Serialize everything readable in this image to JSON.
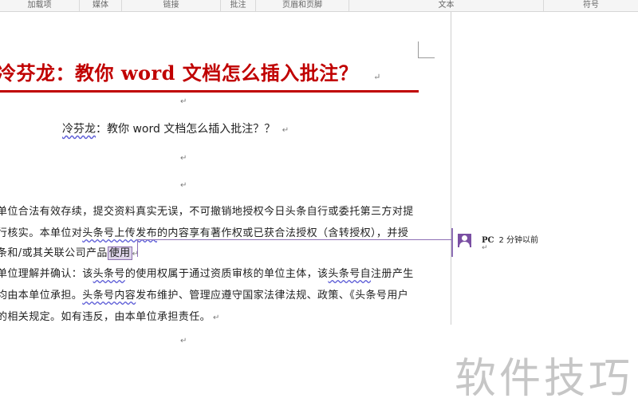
{
  "ribbon": {
    "groups": [
      "加载项",
      "媒体",
      "链接",
      "批注",
      "页眉和页脚",
      "文本",
      "符号"
    ]
  },
  "document": {
    "title": "冷芬龙：教你 word 文档怎么插入批注？",
    "subtitle_name": "冷芬龙",
    "subtitle_rest": "：教你 word 文档怎么插入批注？？",
    "paragraph_mark": "↵",
    "lines": {
      "l1": "单位合法有效存续，提交资料真实无误，不可撤销地授权今日头条自行或委托第三方对提",
      "l2_a": "行核实。本单位对",
      "l2_b": "头条号上传发布",
      "l2_c": "的内容享有著作权或已获合法授权（含转授权），并授",
      "l3_a": "条和/或其关联公司产品",
      "l3_hl": "使用",
      "l4_a": "单位理解并确认：该",
      "l4_b": "头条号",
      "l4_c": "的使用权属于通过资质审核的单位主体，该",
      "l4_d": "头条号自",
      "l4_e": "注册产生",
      "l5_a": "均由本单位承担。",
      "l5_b": "头条号内容",
      "l5_c": "发布维护、管理应遵守国家法律法规、政策、《头条号用户",
      "l6": "的相关规定。如有违反，由本单位承担责任。"
    }
  },
  "comment": {
    "author": "PC",
    "time": "2 分钟以前",
    "mark": "↵"
  },
  "watermark": "软件技巧",
  "colors": {
    "title_red": "#c00000",
    "comment_purple": "#8e70b6",
    "ribbon_bg": "#f5f5f5"
  }
}
